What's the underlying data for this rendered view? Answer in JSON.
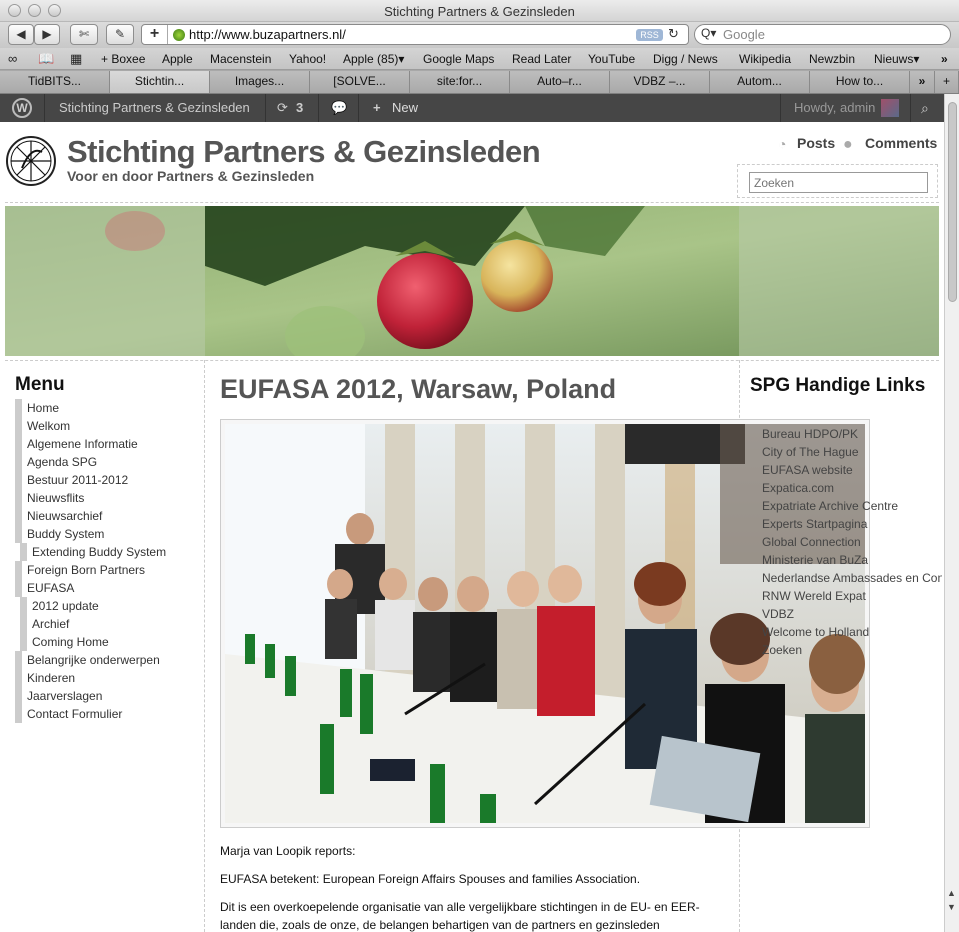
{
  "window": {
    "title": "Stichting Partners & Gezinsleden"
  },
  "toolbar": {
    "url": "http://www.buzapartners.nl/",
    "rss": "RSS",
    "search_placeholder": "Google"
  },
  "bookmarks": [
    "+ Boxee",
    "Apple",
    "Macenstein",
    "Yahoo!",
    "Apple (85)▾",
    "Google Maps",
    "Read Later",
    "YouTube",
    "Digg / News",
    "Wikipedia",
    "Newzbin",
    "Nieuws▾"
  ],
  "tabs": [
    "TidBITS...",
    "Stichtin...",
    "Images...",
    "[SOLVE...",
    "site:for...",
    "Auto–r...",
    "VDBZ –...",
    "Autom...",
    "How to..."
  ],
  "adminbar": {
    "site_name": "Stichting Partners & Gezinsleden",
    "updates": "3",
    "new_label": "New",
    "howdy": "Howdy, admin"
  },
  "header": {
    "title": "Stichting Partners & Gezinsleden",
    "tagline": "Voor en door Partners & Gezinsleden",
    "posts_feed": "Posts",
    "comments_feed": "Comments",
    "search_placeholder": "Zoeken"
  },
  "menu": {
    "title": "Menu",
    "items": [
      {
        "label": "Home",
        "sub": false
      },
      {
        "label": "Welkom",
        "sub": false
      },
      {
        "label": "Algemene Informatie",
        "sub": false
      },
      {
        "label": "Agenda SPG",
        "sub": false
      },
      {
        "label": "Bestuur 2011-2012",
        "sub": false
      },
      {
        "label": "Nieuwsflits",
        "sub": false
      },
      {
        "label": "Nieuwsarchief",
        "sub": false
      },
      {
        "label": "Buddy System",
        "sub": false
      },
      {
        "label": "Extending Buddy System",
        "sub": true
      },
      {
        "label": "Foreign Born Partners",
        "sub": false
      },
      {
        "label": "EUFASA",
        "sub": false
      },
      {
        "label": "2012 update",
        "sub": true
      },
      {
        "label": "Archief",
        "sub": true
      },
      {
        "label": "Coming Home",
        "sub": true
      },
      {
        "label": "Belangrijke onderwerpen",
        "sub": false
      },
      {
        "label": "Kinderen",
        "sub": false
      },
      {
        "label": "Jaarverslagen",
        "sub": false
      },
      {
        "label": "Contact Formulier",
        "sub": false
      }
    ]
  },
  "post": {
    "title": "EUFASA 2012, Warsaw, Poland",
    "byline": "Marja van Loopik reports:",
    "para1": "EUFASA betekent: European Foreign Affairs Spouses and families Association.",
    "para2": "Dit is een overkoepelende organisatie van alle vergelijkbare stichtingen in de EU- en EER- landen die, zoals de onze, de belangen behartigen van de partners en gezinsleden"
  },
  "sidebar": {
    "title": "SPG Handige Links",
    "links": [
      "Bureau HDPO/PK",
      "City of The Hague",
      "EUFASA website",
      "Expatica.com",
      "Expatriate Archive Centre",
      "Experts Startpagina",
      "Global Connection",
      "Ministerie van BuZa",
      "Nederlandse Ambassades en Consulaten",
      "RNW Wereld Expat",
      "VDBZ",
      "Welcome to Holland",
      "Zoeken"
    ]
  }
}
